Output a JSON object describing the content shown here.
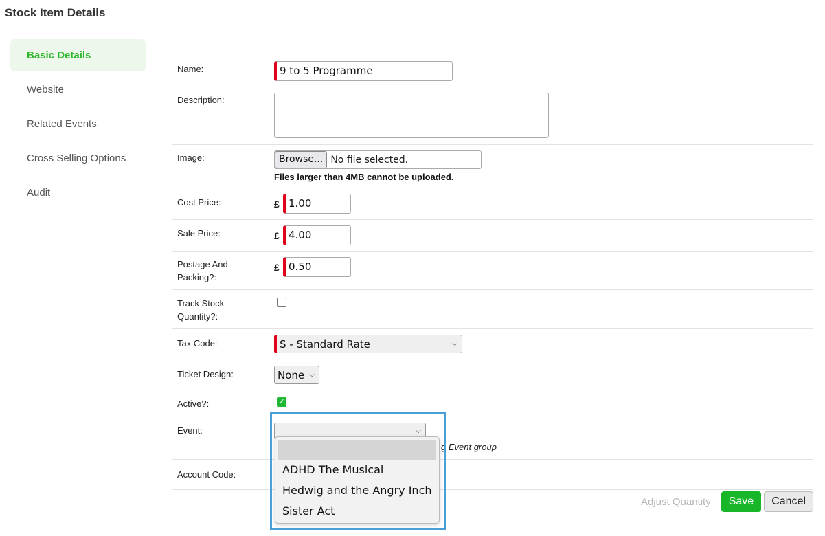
{
  "page_title": "Stock Item Details",
  "sidebar": {
    "items": [
      {
        "label": "Basic Details",
        "active": true
      },
      {
        "label": "Website",
        "active": false
      },
      {
        "label": "Related Events",
        "active": false
      },
      {
        "label": "Cross Selling Options",
        "active": false
      },
      {
        "label": "Audit",
        "active": false
      }
    ]
  },
  "form": {
    "name": {
      "label": "Name:",
      "value": "9 to 5 Programme"
    },
    "description": {
      "label": "Description:",
      "value": ""
    },
    "image": {
      "label": "Image:",
      "browse_label": "Browse...",
      "file_status": "No file selected.",
      "note": "Files larger than 4MB cannot be uploaded."
    },
    "cost_price": {
      "label": "Cost Price:",
      "currency": "£",
      "value": "1.00"
    },
    "sale_price": {
      "label": "Sale Price:",
      "currency": "£",
      "value": "4.00"
    },
    "postage": {
      "label": "Postage And Packing?:",
      "currency": "£",
      "value": "0.50"
    },
    "track_stock": {
      "label": "Track Stock Quantity?:",
      "checked": false
    },
    "tax_code": {
      "label": "Tax Code:",
      "value": "S - Standard Rate"
    },
    "ticket_design": {
      "label": "Ticket Design:",
      "value": "None"
    },
    "active": {
      "label": "Active?:",
      "checked": true,
      "check_glyph": "✓"
    },
    "event": {
      "label": "Event:",
      "value": "",
      "hint_partial": "g Event group",
      "options": [
        "",
        "ADHD The Musical",
        "Hedwig and the Angry Inch",
        "Sister Act"
      ]
    },
    "account_code": {
      "label": "Account Code:"
    }
  },
  "footer": {
    "adjust_label": "Adjust Quantity",
    "save_label": "Save",
    "cancel_label": "Cancel"
  },
  "colors": {
    "accent_green": "#2eb82e",
    "required_marker": "#e1001a",
    "save_button": "#18b72a",
    "highlight_box": "#4a9fd6"
  },
  "icons": {
    "select_chevron": "chevron-down-icon"
  }
}
